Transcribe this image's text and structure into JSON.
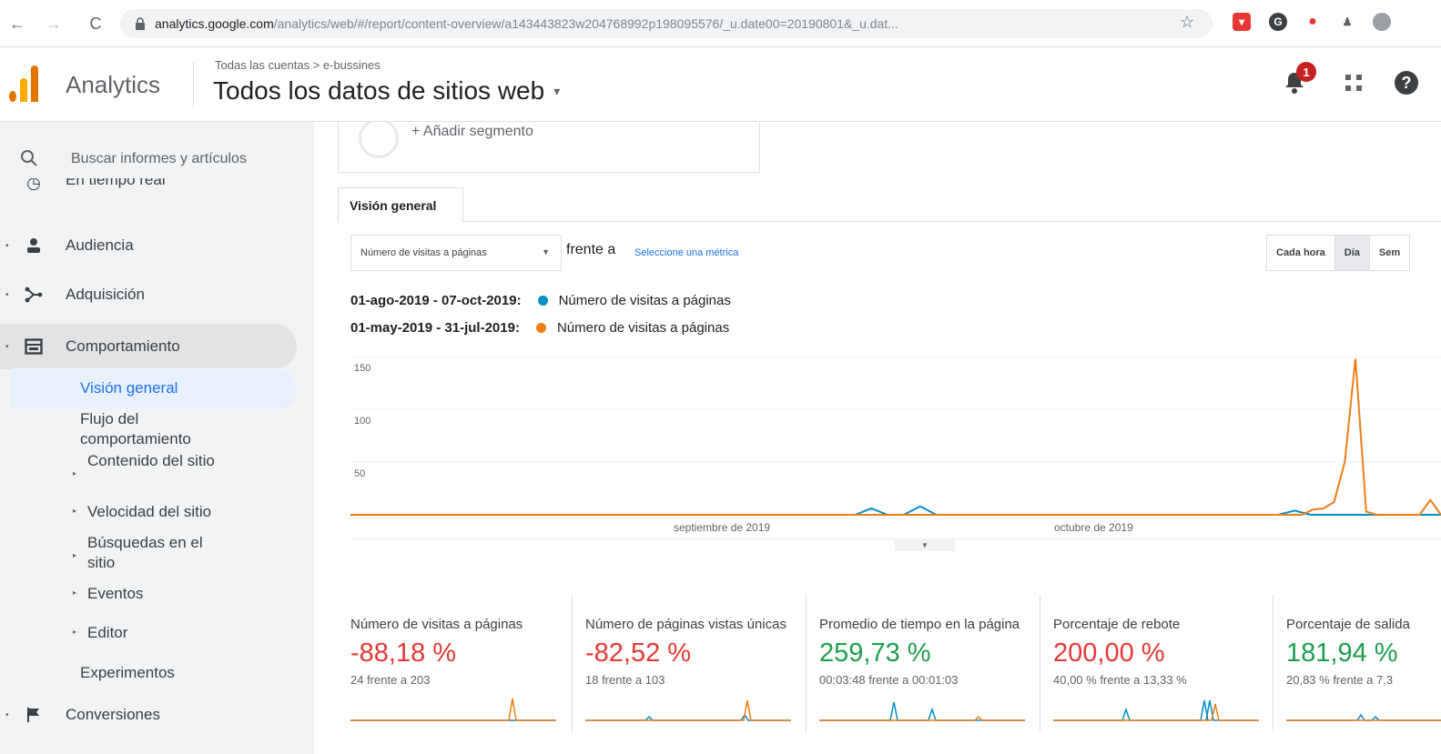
{
  "browser": {
    "url_host": "analytics.google.com",
    "url_path": "/analytics/web/#/report/content-overview/a143443823w204768992p198095576/_u.date00=20190801&_u.dat..."
  },
  "header": {
    "app_name": "Analytics",
    "breadcrumb": "Todas las cuentas > e-bussines",
    "property": "Todos los datos de sitios web",
    "notifications_count": "1"
  },
  "sidebar": {
    "search_placeholder": "Buscar informes y artículos",
    "realtime": "En tiempo real",
    "items": [
      {
        "label": "Audiencia",
        "icon": "person-icon"
      },
      {
        "label": "Adquisición",
        "icon": "acquisition-icon"
      },
      {
        "label": "Comportamiento",
        "icon": "behavior-icon"
      }
    ],
    "behavior_sub": {
      "overview": "Visión general",
      "flow": "Flujo del comportamiento",
      "site_content": "Contenido del sitio",
      "site_speed": "Velocidad del sitio",
      "site_search": "Búsquedas en el sitio",
      "events": "Eventos",
      "publisher": "Editor",
      "experiments": "Experimentos"
    },
    "conversions": "Conversiones"
  },
  "main": {
    "segment_label": "+ Añadir segmento",
    "tab": "Visión general",
    "metric_select": "Número de visitas a páginas",
    "vs_label": "frente a",
    "select_metric_link": "Seleccione una métrica",
    "granularity": [
      "Cada hora",
      "Día",
      "Sem"
    ],
    "legend": [
      {
        "range": "01-ago-2019 - 07-oct-2019:",
        "metric": "Número de visitas a páginas",
        "color": "#058dc7"
      },
      {
        "range": "01-may-2019 - 31-jul-2019:",
        "metric": "Número de visitas a páginas",
        "color": "#ed7e17"
      }
    ]
  },
  "chart_data": {
    "type": "line",
    "x_labels": [
      "septiembre de 2019",
      "octubre de 2019"
    ],
    "ylim": [
      0,
      150
    ],
    "yticks": [
      "150",
      "100",
      "50"
    ],
    "series": [
      {
        "name": "01-ago-2019 - 07-oct-2019",
        "color": "#058dc7",
        "values": [
          0,
          0,
          0,
          0,
          0,
          0,
          0,
          0,
          0,
          0,
          0,
          0,
          0,
          0,
          0,
          0,
          0,
          0,
          0,
          0,
          0,
          0,
          0,
          0,
          0,
          0,
          0,
          0,
          0,
          0,
          0,
          0,
          6,
          0,
          0,
          8,
          0,
          0,
          0,
          0,
          0,
          0,
          0,
          0,
          0,
          0,
          0,
          0,
          0,
          0,
          0,
          0,
          0,
          0,
          0,
          0,
          0,
          0,
          4,
          0,
          0,
          0,
          0,
          0,
          0,
          0,
          0,
          0
        ]
      },
      {
        "name": "01-may-2019 - 31-jul-2019",
        "color": "#ed7e17",
        "values": [
          0,
          0,
          0,
          0,
          0,
          0,
          0,
          0,
          0,
          0,
          0,
          0,
          0,
          0,
          0,
          0,
          0,
          0,
          0,
          0,
          0,
          0,
          0,
          0,
          0,
          0,
          0,
          0,
          0,
          0,
          0,
          0,
          0,
          0,
          0,
          0,
          0,
          0,
          0,
          0,
          0,
          0,
          0,
          0,
          0,
          0,
          0,
          0,
          0,
          0,
          0,
          0,
          0,
          0,
          0,
          0,
          0,
          0,
          0,
          0,
          0,
          0,
          0,
          0,
          0,
          0,
          0,
          0,
          0,
          0,
          0,
          0,
          0,
          0,
          0,
          0,
          0,
          0,
          0,
          0,
          0,
          0,
          0,
          0,
          0,
          0,
          0,
          0,
          0,
          0,
          5,
          6,
          12,
          50,
          148,
          3,
          0,
          0,
          0,
          0,
          0,
          14,
          0
        ]
      }
    ]
  },
  "scorecards": [
    {
      "title": "Número de visitas a páginas",
      "value": "-88,18 %",
      "trend": "neg",
      "compare": "24 frente a 203"
    },
    {
      "title": "Número de páginas vistas únicas",
      "value": "-82,52 %",
      "trend": "neg",
      "compare": "18 frente a 103"
    },
    {
      "title": "Promedio de tiempo en la página",
      "value": "259,73 %",
      "trend": "pos",
      "compare": "00:03:48 frente a 00:01:03"
    },
    {
      "title": "Porcentaje de rebote",
      "value": "200,00 %",
      "trend": "neg",
      "compare": "40,00 % frente a 13,33 %"
    },
    {
      "title": "Porcentaje de salida",
      "value": "181,94 %",
      "trend": "pos",
      "compare": "20,83 % frente a 7,3"
    }
  ]
}
